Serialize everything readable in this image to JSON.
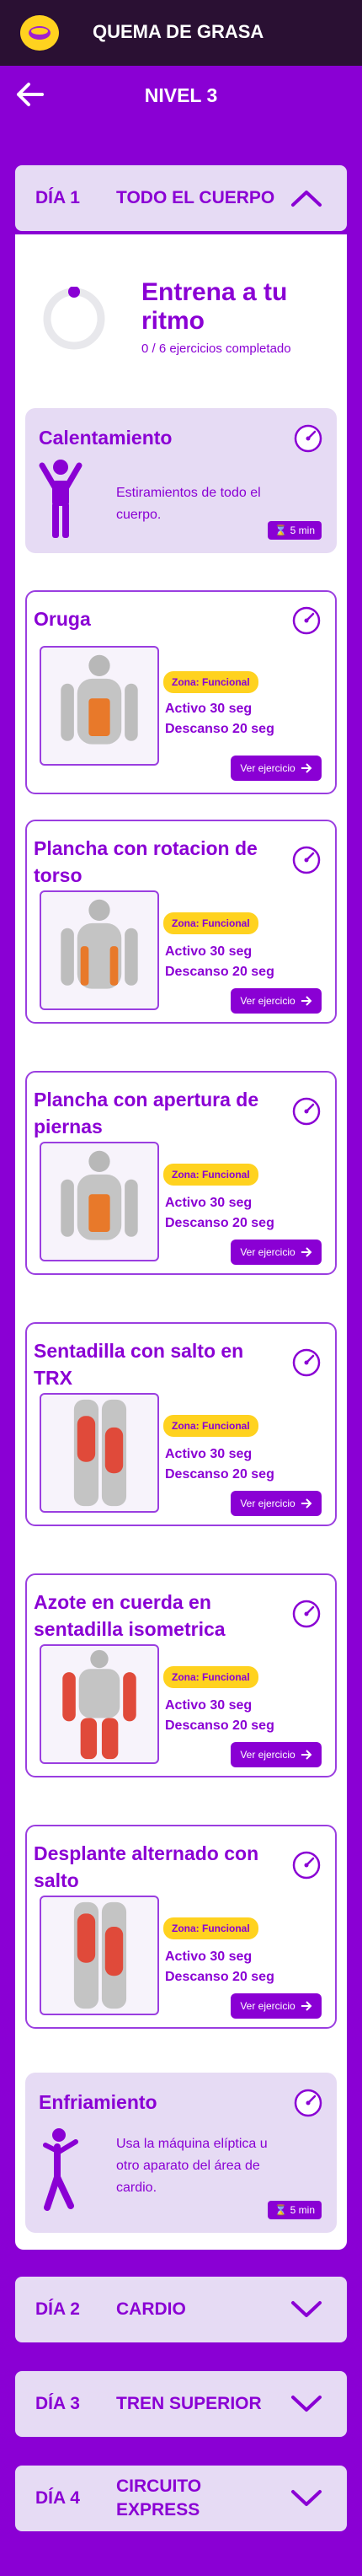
{
  "app": {
    "title": "QUEMA DE GRASA"
  },
  "nav": {
    "title": "NIVEL 3"
  },
  "colors": {
    "primary": "#8a00d4",
    "accent": "#ffd21f",
    "topbar": "#2a1033",
    "card": "#e6dbf4"
  },
  "days": [
    {
      "label": "DÍA 1",
      "name": "TODO EL CUERPO",
      "expanded": true
    },
    {
      "label": "DÍA 2",
      "name": "CARDIO",
      "expanded": false
    },
    {
      "label": "DÍA 3",
      "name": "TREN SUPERIOR",
      "expanded": false
    },
    {
      "label": "DÍA 4",
      "name": "CIRCUITO EXPRESS",
      "expanded": false
    }
  ],
  "rhythm": {
    "title": "Entrena a tu ritmo",
    "progress": "0 / 6 ejercicios completado",
    "completed": 0,
    "total": 6
  },
  "warmup": {
    "title": "Calentamiento",
    "desc": "Estiramientos de todo el cuerpo.",
    "badge": "5 min"
  },
  "cooldown": {
    "title": "Enfriamiento",
    "desc": "Usa la máquina elíptica u otro aparato del área de cardio.",
    "badge": "5 min"
  },
  "exercises": [
    {
      "title": "Oruga",
      "zone": "Zona: Funcional",
      "active": "Activo 30 seg",
      "rest": "Descanso 20 seg",
      "button": "Ver ejercicio"
    },
    {
      "title": "Plancha con rotacion de torso",
      "zone": "Zona: Funcional",
      "active": "Activo 30 seg",
      "rest": "Descanso 20 seg",
      "button": "Ver ejercicio"
    },
    {
      "title": "Plancha con apertura de piernas",
      "zone": "Zona: Funcional",
      "active": "Activo 30 seg",
      "rest": "Descanso 20 seg",
      "button": "Ver ejercicio"
    },
    {
      "title": "Sentadilla con salto en TRX",
      "zone": "Zona: Funcional",
      "active": "Activo 30 seg",
      "rest": "Descanso 20 seg",
      "button": "Ver ejercicio"
    },
    {
      "title": "Azote en cuerda en sentadilla isometrica",
      "zone": "Zona: Funcional",
      "active": "Activo 30 seg",
      "rest": "Descanso 20 seg",
      "button": "Ver ejercicio"
    },
    {
      "title": "Desplante alternado con salto",
      "zone": "Zona: Funcional",
      "active": "Activo 30 seg",
      "rest": "Descanso 20 seg",
      "button": "Ver ejercicio"
    }
  ]
}
